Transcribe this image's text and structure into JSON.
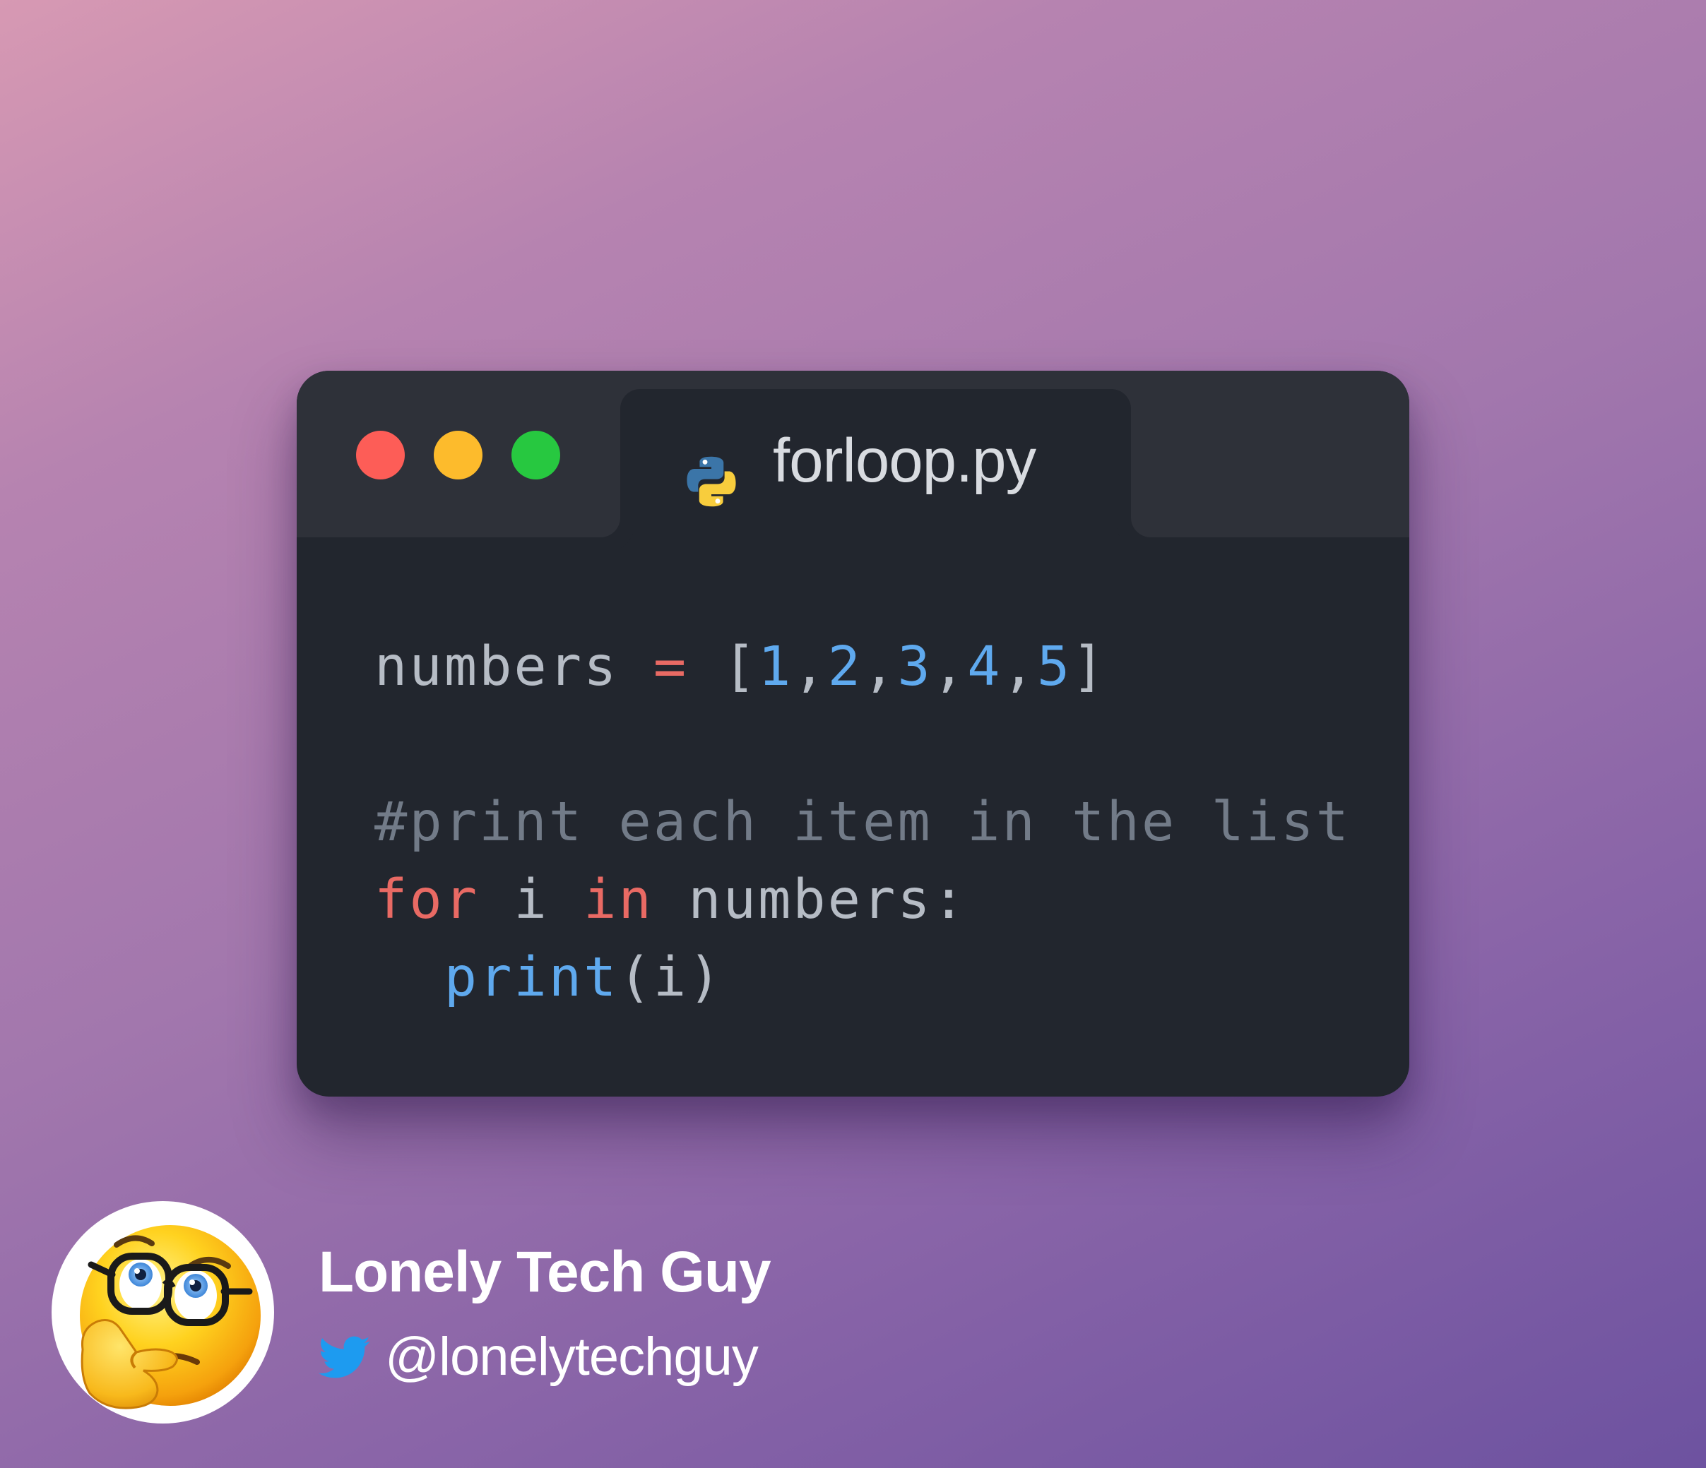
{
  "window": {
    "tab": {
      "filename": "forloop.py",
      "icon": "python-icon"
    },
    "traffic_lights": {
      "close_color": "#fd5d57",
      "minimize_color": "#fdbb2c",
      "maximize_color": "#27c840"
    }
  },
  "code": {
    "line1": {
      "var": "numbers",
      "op": "=",
      "open": "[",
      "n1": "1",
      "n2": "2",
      "n3": "3",
      "n4": "4",
      "n5": "5",
      "comma": ",",
      "close": "]"
    },
    "line3": {
      "comment": "#print each item in the list"
    },
    "line4": {
      "kw_for": "for",
      "var": "i",
      "kw_in": "in",
      "iter": "numbers:"
    },
    "line5": {
      "fn": "print",
      "args": "(i)"
    }
  },
  "author": {
    "name": "Lonely Tech Guy",
    "handle": "@lonelytechguy",
    "handle_icon": "twitter-icon",
    "avatar": "thinking-face-with-glasses-emoji"
  },
  "colors": {
    "keyword": "#e96a64",
    "number": "#5fa9ee",
    "comment": "#727b88",
    "plain": "#b6bcc5",
    "window_bg": "#22262e",
    "titlebar_bg": "#2e3139"
  }
}
